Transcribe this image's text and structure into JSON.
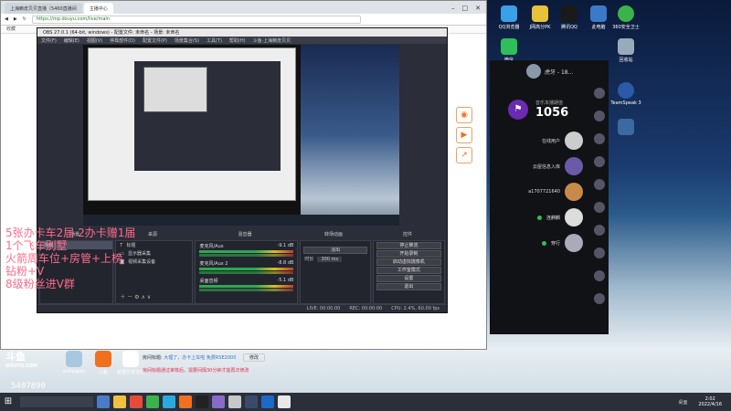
{
  "browser": {
    "tabs": [
      "上海赖皮贝贝直播（5460直播间",
      "主播中心"
    ],
    "url": "https://mp.douyu.com/live/main",
    "bookmark": "收藏"
  },
  "obs": {
    "title": "OBS 27.0.1 (64-bit, windows) - 配置文件: 未命名 - 场景: 未命名",
    "menu": [
      "文件(F)",
      "编辑(E)",
      "视图(V)",
      "停靠部件(D)",
      "配置文件(P)",
      "场景集合(S)",
      "工具(T)",
      "帮助(H)",
      "斗鱼·上海赖皮贝贝"
    ],
    "dock_titles": [
      "场景",
      "来源",
      "混音器",
      "转场动画",
      "控件"
    ],
    "scenes": [
      "场景"
    ],
    "sources": [
      "标题",
      "显示器采集",
      "视频采集设备"
    ],
    "mixer": [
      {
        "name": "麦克风/Aux",
        "db": "-9.1 dB"
      },
      {
        "name": "麦克风/Aux 2",
        "db": "-8.8 dB"
      },
      {
        "name": "桌面音频",
        "db": "-5.1 dB"
      }
    ],
    "transition": {
      "type": "淡出",
      "duration_label": "时长",
      "duration": "300 ms"
    },
    "controls": [
      "停止推流",
      "开始录制",
      "启动虚拟摄像机",
      "工作室模式",
      "设置",
      "退出"
    ],
    "status": {
      "live": "LIVE: 00:00:00",
      "rec": "REC: 00:00:00",
      "cpu": "CPU: 2.4%, 60.00 fps"
    }
  },
  "overlay_lines": [
    "5张办卡车2届 2办卡赠1届",
    "1个飞车别墅",
    "火箭周车位+房管+上榜",
    "钻粉+V",
    "8级粉丝进V群"
  ],
  "info": {
    "label": "房间标题:",
    "title": "大理了，办卡上车啦 免费RSE2000",
    "edit": "修改",
    "announcement": "房间标题通过审核后，需要间隔30分钟才能再次修改"
  },
  "chat": {
    "user": "虎牙 - 18...",
    "badge_label": "音乐本播期值",
    "value": "1056",
    "items": [
      "在线用户",
      "云屋信息入库",
      "a1707721640",
      "连麒麟",
      "穿行"
    ]
  },
  "desktop_icons": [
    "QQ浏览器",
    "J网高分PK",
    "腾讯QQ",
    "此电脑",
    "360安全卫士",
    "微信",
    "回收站",
    "TeamSpeak 3",
    "wallpaper",
    "斗鱼",
    "新建文本文档"
  ],
  "overlay_logo": "斗鱼",
  "overlay_logo_sub": "DOUYU.COM",
  "room_id": "5407890",
  "taskbar": {
    "start": "⊞",
    "tray": "桌面",
    "time": "2:02",
    "date": "2022/4/16"
  },
  "colors": {
    "overlay": "#ff6a8a",
    "badge": "#6a2bb0",
    "accent": "#f07020"
  }
}
